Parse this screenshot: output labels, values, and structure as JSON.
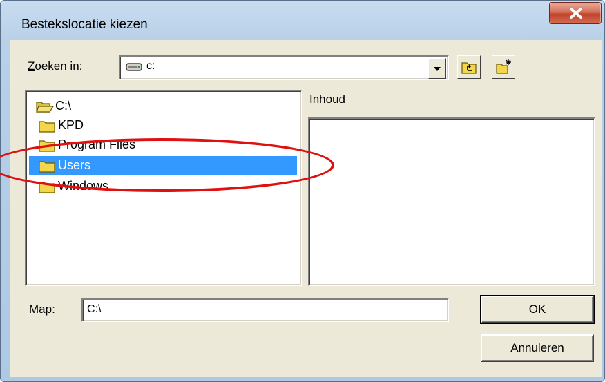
{
  "window": {
    "title": "Bestekslocatie kiezen"
  },
  "look_in": {
    "label": "Zoeken in:",
    "accesskey": "Z",
    "rest": "oeken in:",
    "value": "c:"
  },
  "tree": {
    "items": [
      {
        "label": "C:\\"
      },
      {
        "label": "KPD"
      },
      {
        "label": "Program Files"
      },
      {
        "label": "Users",
        "selected": true
      },
      {
        "label": "Windows"
      }
    ]
  },
  "contents": {
    "label": "Inhoud"
  },
  "folder": {
    "label": "Map:",
    "accesskey": "M",
    "rest": "ap:",
    "value": "C:\\"
  },
  "buttons": {
    "ok": "OK",
    "cancel": "Annuleren"
  },
  "icons": {
    "close": "close-icon",
    "drive": "drive-icon",
    "up": "up-folder-icon",
    "new": "new-folder-icon",
    "dropdown": "chevron-down-icon",
    "folder": "folder-icon"
  },
  "colors": {
    "selection": "#3399ff",
    "annotation": "#e01010",
    "close": "#c0452c"
  }
}
